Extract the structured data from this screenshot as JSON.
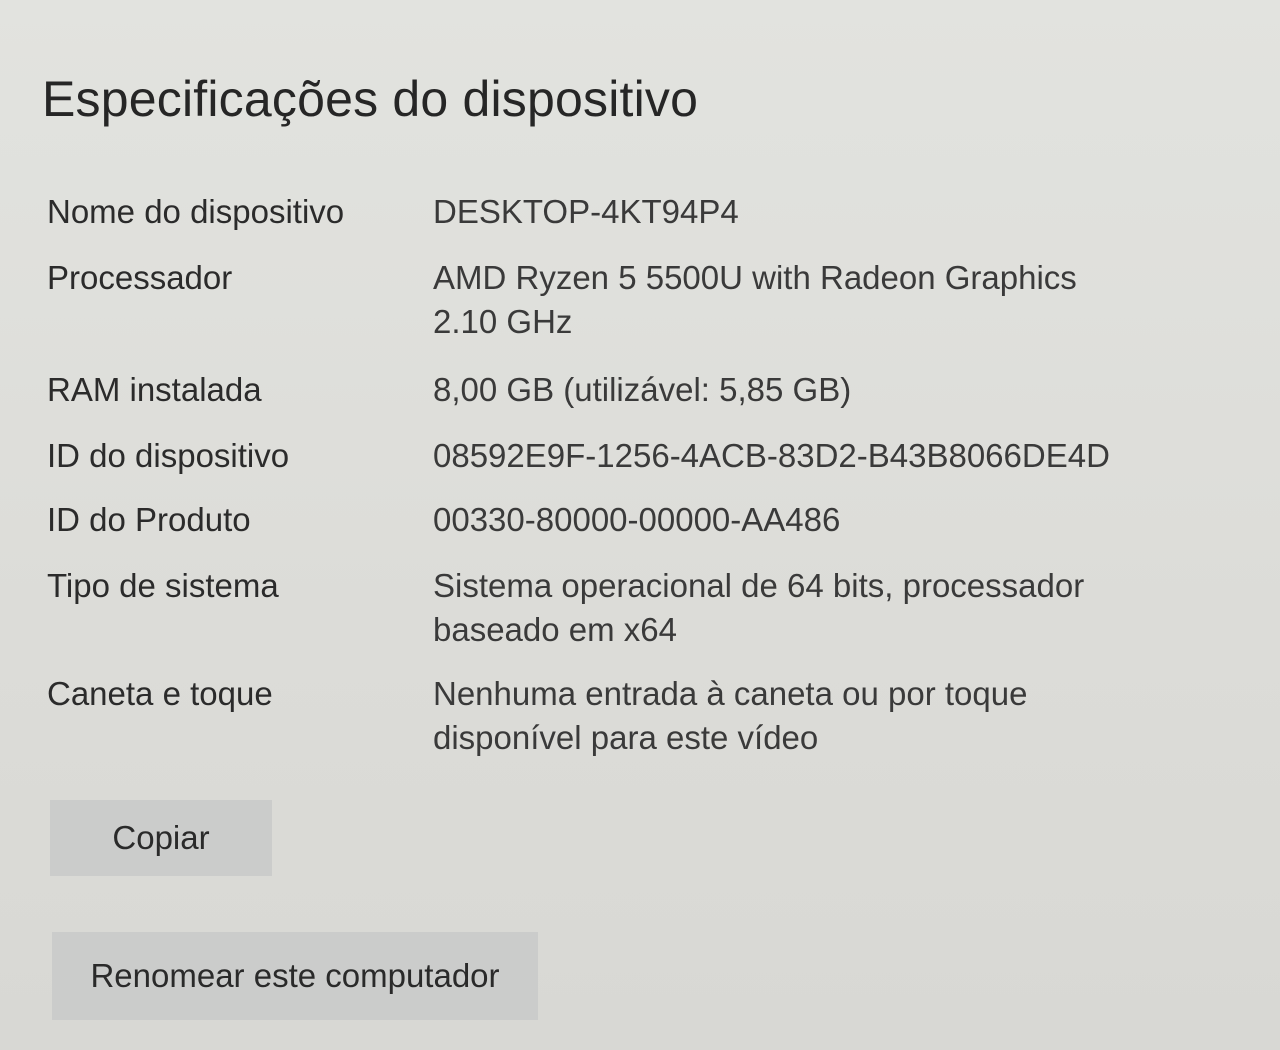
{
  "section": {
    "title": "Especificações do dispositivo"
  },
  "specs": {
    "device_name": {
      "label": "Nome do dispositivo",
      "value": "DESKTOP-4KT94P4"
    },
    "processor": {
      "label": "Processador",
      "value": "AMD Ryzen 5 5500U with Radeon Graphics 2.10 GHz"
    },
    "ram": {
      "label": "RAM instalada",
      "value": "8,00 GB (utilizável: 5,85 GB)"
    },
    "device_id": {
      "label": "ID do dispositivo",
      "value": "08592E9F-1256-4ACB-83D2-B43B8066DE4D"
    },
    "product_id": {
      "label": "ID do Produto",
      "value": "00330-80000-00000-AA486"
    },
    "system_type": {
      "label": "Tipo de sistema",
      "value": "Sistema operacional de 64 bits, processador baseado em x64"
    },
    "pen_touch": {
      "label": "Caneta e toque",
      "value": "Nenhuma entrada à caneta ou por toque disponível para este vídeo"
    }
  },
  "actions": {
    "copy_label": "Copiar",
    "rename_label": "Renomear este computador"
  }
}
